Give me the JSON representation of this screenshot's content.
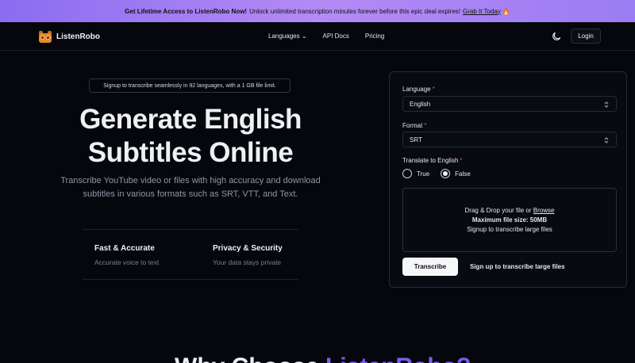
{
  "promo": {
    "headline": "Get Lifetime Access to ListenRobo Now!",
    "body": "Unlock unlimited transcription minutes forever before this epic deal expires!",
    "link": "Grab It Today",
    "emoji": "🔥"
  },
  "nav": {
    "brand": "ListenRobo",
    "items": [
      "Languages ⌄",
      "API Docs",
      "Pricing"
    ],
    "login": "Login",
    "theme_icon": "moon-icon"
  },
  "hero": {
    "pill": "Signup to transcribe seamlessly in 92 languages, with a 1 GB file limit.",
    "title_line1": "Generate English",
    "title_line2": "Subtitles Online",
    "subtitle": "Transcribe YouTube video or files with high accuracy and download subtitles in various formats such as SRT, VTT, and Text.",
    "features": [
      {
        "title": "Fast & Accurate",
        "desc": "Accurate voice to text"
      },
      {
        "title": "Privacy & Security",
        "desc": "Your data stays private"
      }
    ]
  },
  "form": {
    "language_label": "Language",
    "language_value": "English",
    "format_label": "Format",
    "format_value": "SRT",
    "required_mark": "*",
    "translate_label": "Translate to English",
    "translate_options": [
      "True",
      "False"
    ],
    "translate_selected": "False",
    "drop_text": "Drag & Drop your file or",
    "drop_link": "Browse",
    "drop_max": "Maximum file size: 50MB",
    "drop_note": "Signup to transcribe large files",
    "submit": "Transcribe",
    "submit_note": "Sign up to transcribe large files"
  },
  "section": {
    "heading_start": "Why Choose",
    "heading_accent": "ListenRobo?"
  }
}
